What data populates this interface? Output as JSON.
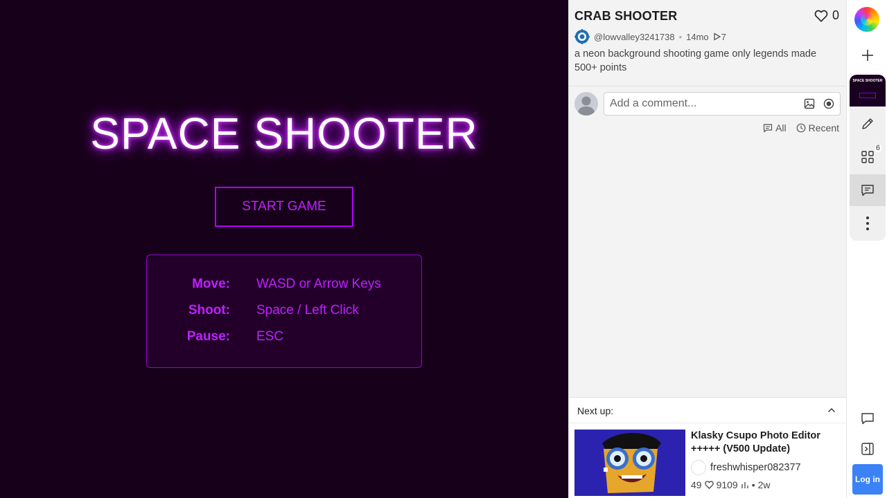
{
  "game": {
    "title": "SPACE SHOOTER",
    "start_button": "START GAME",
    "controls": [
      {
        "key": "Move:",
        "value": "WASD or Arrow Keys"
      },
      {
        "key": "Shoot:",
        "value": "Space / Left Click"
      },
      {
        "key": "Pause:",
        "value": "ESC"
      }
    ],
    "accent_color": "#b400ff",
    "background_color": "#170019"
  },
  "project": {
    "title": "CRAB SHOOTER",
    "likes": "0",
    "author": "@lowvalley3241738",
    "age": "14mo",
    "plays": "7",
    "description": "a neon background shooting game only legends made 500+ points"
  },
  "comments": {
    "placeholder": "Add a comment...",
    "filter_all": "All",
    "filter_recent": "Recent"
  },
  "next_up": {
    "label": "Next up:",
    "title": "Klasky Csupo Photo Editor +++++ (V500 Update)",
    "author": "freshwhisper082377",
    "likes": "49",
    "views": "9109",
    "age": "2w"
  },
  "rail": {
    "thumb_label": "SPACE SHOOTER",
    "badge_count": "6",
    "login_label": "Log in"
  }
}
